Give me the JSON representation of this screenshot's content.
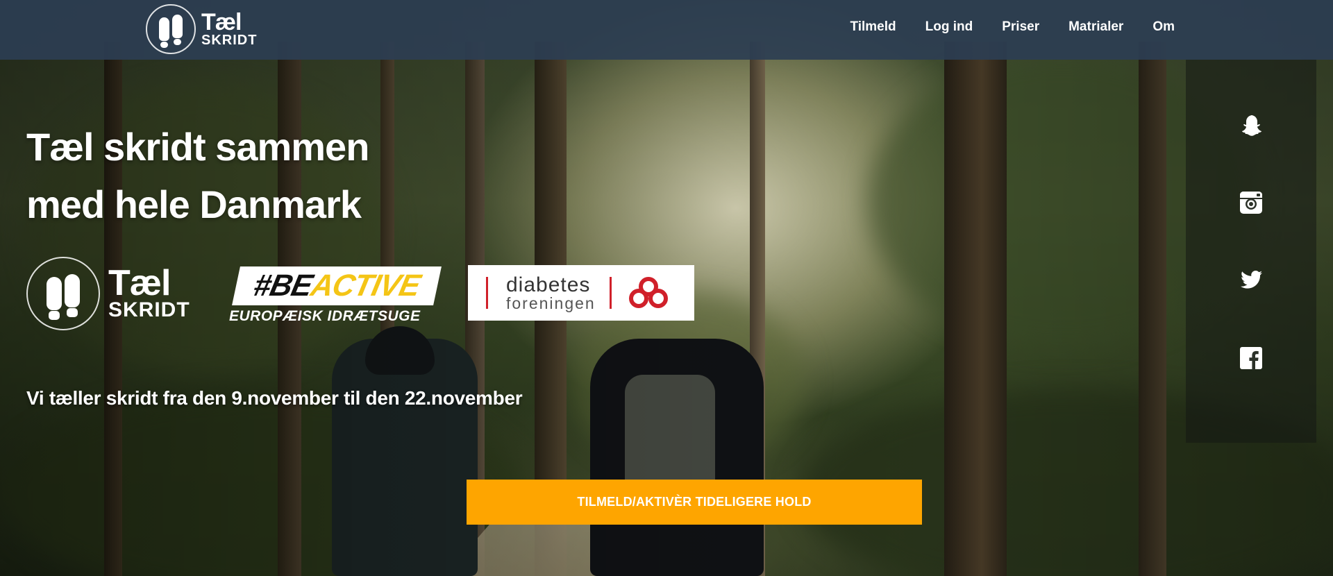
{
  "brand": {
    "logo_line1": "Tæl",
    "logo_line2": "SKRIDT"
  },
  "nav": {
    "items": [
      "Tilmeld",
      "Log ind",
      "Priser",
      "Matrialer",
      "Om"
    ]
  },
  "hero": {
    "headline_line1": "Tæl skridt sammen",
    "headline_line2": "med hele Danmark",
    "dates_text": "Vi tæller skridt fra den 9.november til den 22.november",
    "cta_label": "TILMELD/AKTIVÈR TIDELIGERE HOLD"
  },
  "partners": {
    "tael": {
      "line1": "Tæl",
      "line2": "SKRIDT"
    },
    "beactive": {
      "hash": "#BE",
      "active": "ACTIVE",
      "subtitle": "EUROPÆISK IDRÆTSUGE"
    },
    "diabetes": {
      "line1": "diabetes",
      "line2": "foreningen"
    }
  },
  "social": {
    "icons": [
      "snapchat-icon",
      "instagram-icon",
      "twitter-icon",
      "facebook-icon"
    ]
  },
  "colors": {
    "navbar": "#2c3e52",
    "cta": "#fea500",
    "beactive_accent": "#f4c516",
    "diabetes_red": "#d0202a"
  }
}
